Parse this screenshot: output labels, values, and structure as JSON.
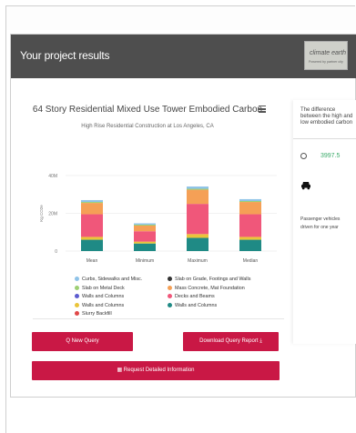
{
  "header": {
    "title": "Your project results",
    "logo_word": "climate earth",
    "logo_sub": "Powered by partner city"
  },
  "chart_data": {
    "type": "bar",
    "title": "64 Story Residential Mixed Use Tower Embodied Carbon",
    "subtitle": "High Rise Residential Construction at Los Angeles, CA",
    "ylabel": "Kg CO2e",
    "yticks": [
      "40M",
      "20M",
      "0"
    ],
    "ylim": [
      0,
      40000000
    ],
    "categories": [
      "Mean",
      "Minimum",
      "Maximum",
      "Median"
    ],
    "series": [
      {
        "name": "Walls and Columns",
        "color": "#1f8a85",
        "values": [
          6000000,
          4000000,
          7000000,
          6000000
        ]
      },
      {
        "name": "Walls and Columns",
        "color": "#eac43a",
        "values": [
          1500000,
          1000000,
          2000000,
          1500000
        ]
      },
      {
        "name": "Decks and Beams",
        "color": "#f0577a",
        "values": [
          12000000,
          5500000,
          16000000,
          12000000
        ]
      },
      {
        "name": "Mass Concrete, Mat Foundation",
        "color": "#f5a056",
        "values": [
          6000000,
          3000000,
          7500000,
          6500000
        ]
      },
      {
        "name": "Slab on Metal Deck",
        "color": "#9dcf73",
        "values": [
          500000,
          500000,
          500000,
          500000
        ]
      },
      {
        "name": "Curbs, Sidewalks and Misc.",
        "color": "#8fc3e8",
        "values": [
          1000000,
          700000,
          1200000,
          1000000
        ]
      }
    ],
    "legend": [
      {
        "label": "Curbs, Sidewalks and Misc.",
        "color": "#8fc3e8"
      },
      {
        "label": "Slab on Grade, Footings and Walls",
        "color": "#333333"
      },
      {
        "label": "Slab on Metal Deck",
        "color": "#9dcf73"
      },
      {
        "label": "Mass Concrete, Mat Foundation",
        "color": "#f5a056"
      },
      {
        "label": "Walls and Columns",
        "color": "#5c5ccf"
      },
      {
        "label": "Decks and Beams",
        "color": "#f0577a"
      },
      {
        "label": "Walls and Columns",
        "color": "#eac43a"
      },
      {
        "label": "Walls and Columns",
        "color": "#1f8a85"
      },
      {
        "label": "Slurry Backfill",
        "color": "#e04848"
      }
    ]
  },
  "side": {
    "head": "The difference between the high and low embodied carbon",
    "value": "3997.5",
    "text": "Passenger vehicles driven for one year"
  },
  "buttons": {
    "new_query": "Q New Query",
    "download": "Download Query Report ⤓",
    "detail": "▦ Request Detailed Information"
  }
}
